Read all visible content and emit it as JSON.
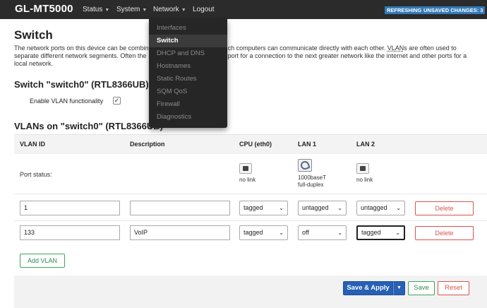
{
  "header": {
    "brand": "GL-MT5000",
    "nav": [
      {
        "label": "Status",
        "has_caret": true
      },
      {
        "label": "System",
        "has_caret": true
      },
      {
        "label": "Network",
        "has_caret": true
      },
      {
        "label": "Logout",
        "has_caret": false
      }
    ],
    "badges": {
      "refreshing": "REFRESHING",
      "unsaved": "UNSAVED CHANGES: 3"
    },
    "badge_color": "#337ab7"
  },
  "network_menu": {
    "items": [
      "Interfaces",
      "Switch",
      "DHCP and DNS",
      "Hostnames",
      "Static Routes",
      "SQM QoS",
      "Firewall",
      "Diagnostics"
    ],
    "active": "Switch"
  },
  "page": {
    "title": "Switch",
    "intro_parts": [
      "The network ports on this device can be combin",
      "ch computers can communicate directly with each other. ",
      "VLAN",
      "s are often used to separate different network segments. Often the",
      "port for a connection to the next greater network like the internet and other ports for a local network."
    ],
    "switch_heading": "Switch \"switch0\" (RTL8366UB)",
    "enable_vlan_label": "Enable VLAN functionality",
    "enable_vlan_checked": "✓",
    "vlans_heading": "VLANs on \"switch0\" (RTL8366UB)"
  },
  "table": {
    "headers": {
      "vlan_id": "VLAN ID",
      "description": "Description",
      "cpu": "CPU (eth0)",
      "lan1": "LAN 1",
      "lan2": "LAN 2"
    },
    "port_status_label": "Port status:",
    "port_status": {
      "cpu": {
        "line1": "no link",
        "line2": ""
      },
      "lan1": {
        "line1": "1000baseT",
        "line2": "full-duplex"
      },
      "lan2": {
        "line1": "no link",
        "line2": ""
      }
    },
    "rows": [
      {
        "vlan_id": "1",
        "description": "",
        "cpu": "tagged",
        "lan1": "untagged",
        "lan2": "untagged",
        "delete": "Delete"
      },
      {
        "vlan_id": "133",
        "description": "VoIP",
        "cpu": "tagged",
        "lan1": "off",
        "lan2": "tagged",
        "delete": "Delete"
      }
    ],
    "add_vlan": "Add VLAN"
  },
  "footer": {
    "save_apply": "Save & Apply",
    "save": "Save",
    "reset": "Reset"
  },
  "colors": {
    "topbar": "#2b2b2b",
    "primary": "#2760b4",
    "success": "#3ba55d",
    "danger": "#d9534f"
  }
}
